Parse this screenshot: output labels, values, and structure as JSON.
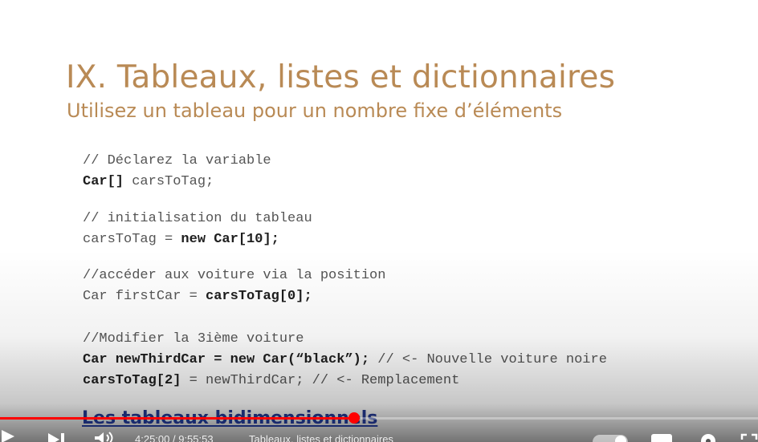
{
  "slide": {
    "title": "IX. Tableaux, listes et dictionnaires",
    "subtitle": "Utilisez un tableau pour un nombre fixe d’éléments",
    "code": [
      [
        {
          "t": "// Déclarez la variable",
          "b": false
        }
      ],
      [
        {
          "t": "Car[]",
          "b": true
        },
        {
          "t": " carsToTag;",
          "b": false
        }
      ],
      [
        {
          "t": "// initialisation du tableau",
          "b": false
        }
      ],
      [
        {
          "t": "carsToTag = ",
          "b": false
        },
        {
          "t": "new Car[10];",
          "b": true
        }
      ],
      [
        {
          "t": "//accéder aux voiture via la position",
          "b": false
        }
      ],
      [
        {
          "t": "Car firstCar = ",
          "b": false
        },
        {
          "t": "carsToTag[0];",
          "b": true
        }
      ],
      [
        {
          "t": "//Modifier la 3ième voiture",
          "b": false
        }
      ],
      [
        {
          "t": "Car newThirdCar = new Car(“black”);",
          "b": true
        },
        {
          "t": " // <- Nouvelle voiture noire",
          "b": false
        }
      ],
      [
        {
          "t": "carsToTag[2]",
          "b": true
        },
        {
          "t": " = newThirdCar; // <- Remplacement",
          "b": false
        }
      ]
    ]
  },
  "player": {
    "chapter_title": "Les tableaux bidimensionnels",
    "progress": 0.467,
    "time_display": "4:25:00 / 9:55:53",
    "chapter_label": "Tableaux, listes et dictionnaires",
    "accent_color": "#ff0000",
    "icons": [
      "play-icon",
      "next-icon",
      "volume-icon",
      "toggle-icon",
      "subtitles-icon",
      "settings-icon",
      "fullscreen-icon"
    ]
  }
}
